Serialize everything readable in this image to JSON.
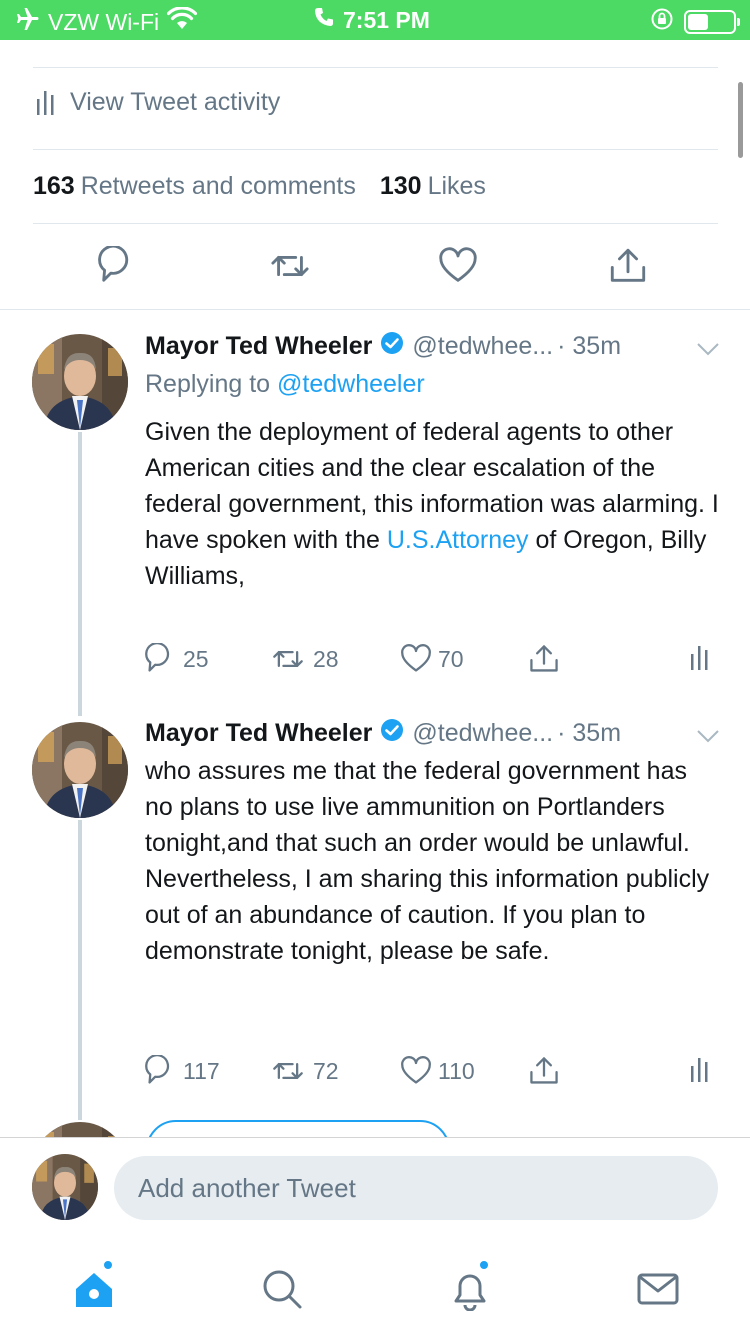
{
  "status_bar": {
    "carrier": "VZW Wi-Fi",
    "time": "7:51 PM",
    "battery_level": 0.45
  },
  "tweet_detail": {
    "activity_label": "View Tweet activity",
    "retweets_count": "163",
    "retweets_label": "Retweets and comments",
    "likes_count": "130",
    "likes_label": "Likes"
  },
  "replies": [
    {
      "name": "Mayor Ted Wheeler",
      "handle": "@tedwhee...",
      "time": "· 35m",
      "replying_prefix": "Replying to",
      "replying_to": "@tedwheeler",
      "text_before": "Given the deployment of federal agents to other American cities and the clear escalation of the federal government, this information was alarming. I have spoken with the ",
      "text_link": "U.S.Attorney",
      "text_after": " of Oregon, Billy Williams,",
      "replies": "25",
      "retweets": "28",
      "likes": "70"
    },
    {
      "name": "Mayor Ted Wheeler",
      "handle": "@tedwhee...",
      "time": "· 35m",
      "text": "who assures me that the federal government has no plans to use live ammunition on Portlanders tonight,and that such an order would be unlawful. Nevertheless, I am sharing this information publicly out of an abundance of caution. If you plan to demonstrate tonight, please be safe.",
      "replies": "117",
      "retweets": "72",
      "likes": "110"
    }
  ],
  "composer": {
    "placeholder": "Add another Tweet"
  },
  "icons": {
    "airplane": "airplane-icon",
    "wifi": "wifi-icon",
    "phone": "phone-icon",
    "orientation_lock": "orientation-lock-icon",
    "battery": "battery-icon",
    "activity": "bar-chart-icon",
    "reply": "reply-icon",
    "retweet": "retweet-icon",
    "like": "heart-icon",
    "share": "share-icon",
    "verified": "verified-badge-icon",
    "chevron": "chevron-down-icon",
    "home": "home-icon",
    "search": "search-icon",
    "notifications": "bell-icon",
    "messages": "mail-icon"
  },
  "colors": {
    "status_bar": "#4cd964",
    "accent": "#1da1f2",
    "secondary_text": "#657786",
    "divider": "#e1e8ed"
  }
}
